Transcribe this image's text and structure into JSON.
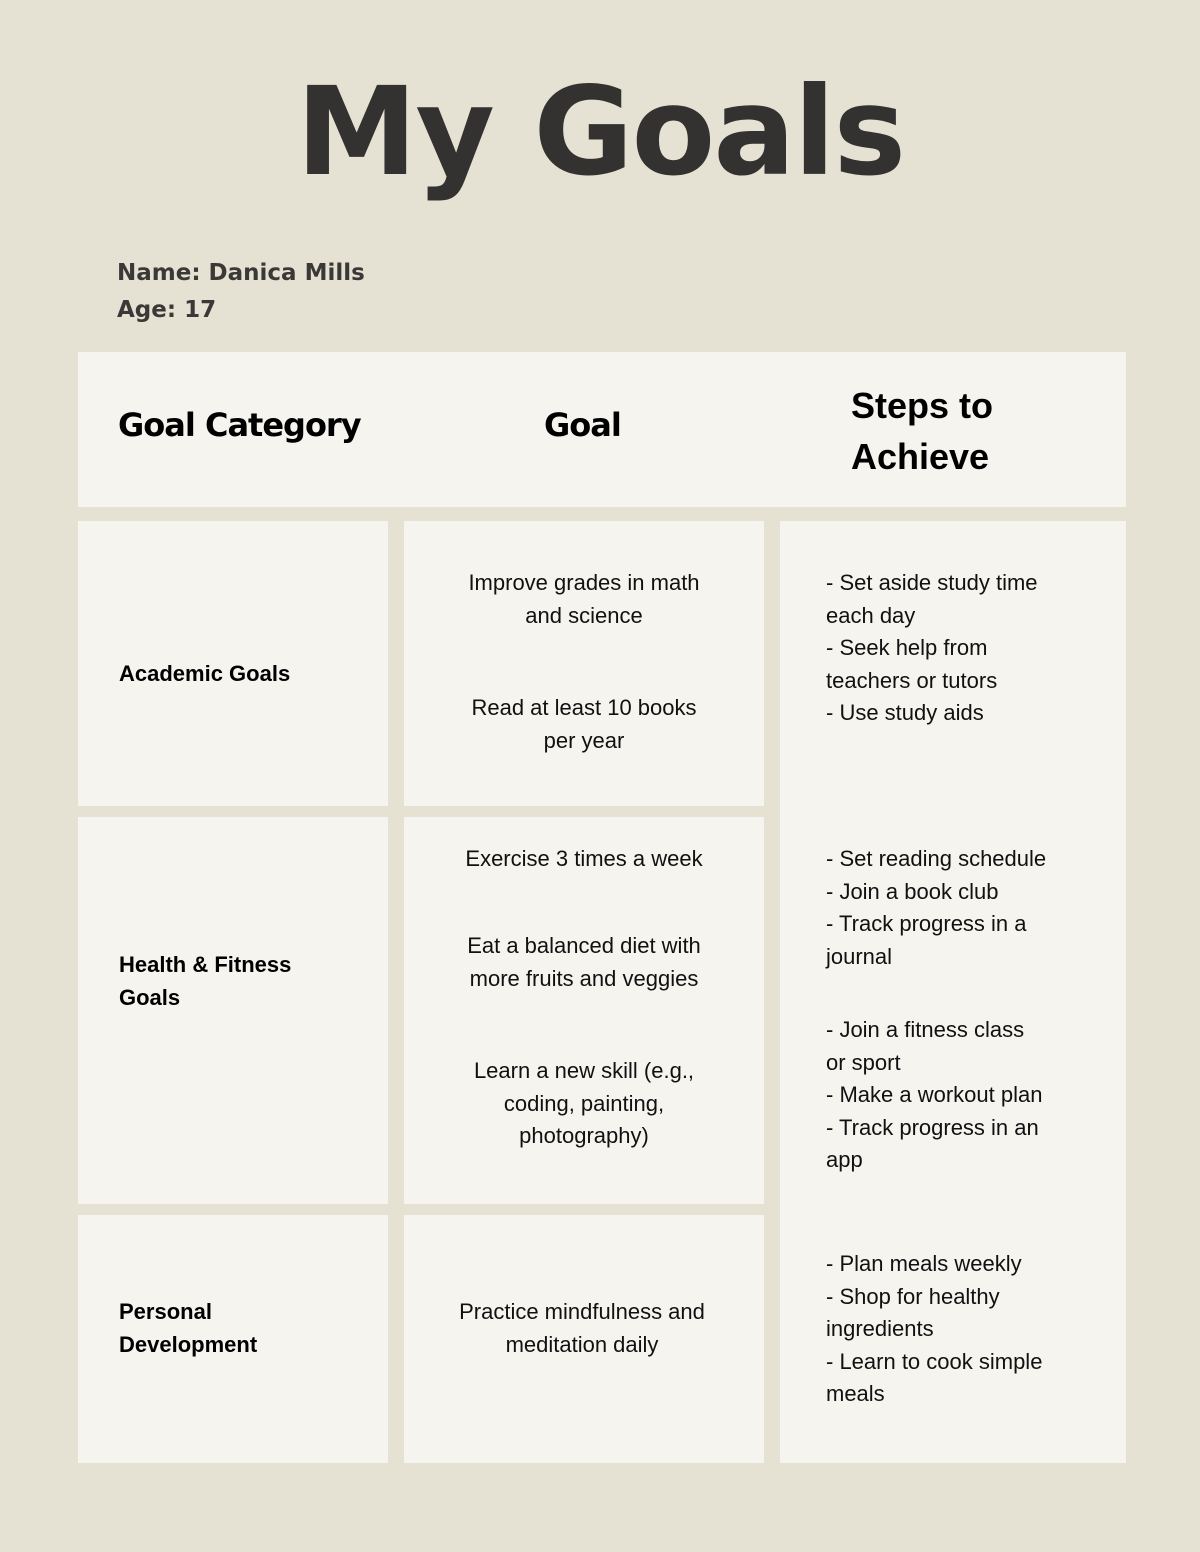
{
  "page": {
    "title": "My Goals",
    "name_line": "Name: Danica Mills",
    "age_line": "Age: 17",
    "colors": {
      "background": "#E5E2D3",
      "cell": "#F5F4EF",
      "title_text": "#333230"
    }
  },
  "table": {
    "headers": {
      "category": "Goal Category",
      "goal": "Goal",
      "steps_line1": "Steps to",
      "steps_line2": "Achieve"
    },
    "categories": [
      {
        "label_lines": [
          "Academic Goals"
        ]
      },
      {
        "label_lines": [
          "Health & Fitness",
          "Goals"
        ]
      },
      {
        "label_lines": [
          "Personal",
          "Development"
        ]
      }
    ],
    "goals": [
      {
        "lines": [
          "Improve grades in math",
          "and science"
        ]
      },
      {
        "lines": [
          "Read at least 10 books",
          "per year"
        ]
      },
      {
        "lines": [
          "Exercise 3 times a week"
        ]
      },
      {
        "lines": [
          "Eat a balanced diet with",
          "more fruits and veggies"
        ]
      },
      {
        "lines": [
          "Learn a new skill (e.g.,",
          "coding, painting,",
          "photography)"
        ]
      },
      {
        "lines": [
          "Practice mindfulness and",
          "meditation daily"
        ]
      }
    ],
    "steps": [
      {
        "lines": [
          "- Set aside study time",
          "each day",
          "- Seek help from",
          "teachers or tutors",
          "- Use study aids"
        ]
      },
      {
        "lines": [
          "- Set reading schedule",
          "- Join a book club",
          "- Track progress in a",
          "journal"
        ]
      },
      {
        "lines": [
          "- Join a fitness class",
          "or sport",
          "- Make a workout plan",
          "- Track progress in an",
          "app"
        ]
      },
      {
        "lines": [
          "- Plan meals weekly",
          "- Shop for healthy",
          "ingredients",
          "- Learn to cook simple",
          "meals"
        ]
      }
    ]
  }
}
